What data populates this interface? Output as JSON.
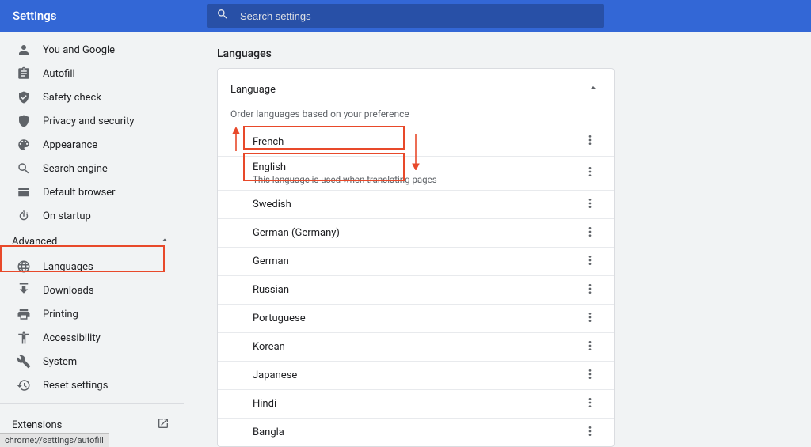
{
  "header": {
    "title": "Settings",
    "search_placeholder": "Search settings"
  },
  "sidebar": {
    "items": [
      {
        "label": "You and Google"
      },
      {
        "label": "Autofill"
      },
      {
        "label": "Safety check"
      },
      {
        "label": "Privacy and security"
      },
      {
        "label": "Appearance"
      },
      {
        "label": "Search engine"
      },
      {
        "label": "Default browser"
      },
      {
        "label": "On startup"
      }
    ],
    "advanced": "Advanced",
    "adv_items": [
      {
        "label": "Languages"
      },
      {
        "label": "Downloads"
      },
      {
        "label": "Printing"
      },
      {
        "label": "Accessibility"
      },
      {
        "label": "System"
      },
      {
        "label": "Reset settings"
      }
    ],
    "extensions": "Extensions"
  },
  "main": {
    "title": "Languages",
    "card_title": "Language",
    "order_hint": "Order languages based on your preference",
    "languages": [
      {
        "name": "French"
      },
      {
        "name": "English",
        "caption": "This language is used when translating pages"
      },
      {
        "name": "Swedish"
      },
      {
        "name": "German (Germany)"
      },
      {
        "name": "German"
      },
      {
        "name": "Russian"
      },
      {
        "name": "Portuguese"
      },
      {
        "name": "Korean"
      },
      {
        "name": "Japanese"
      },
      {
        "name": "Hindi"
      },
      {
        "name": "Bangla"
      }
    ]
  },
  "status_url": "chrome://settings/autofill"
}
